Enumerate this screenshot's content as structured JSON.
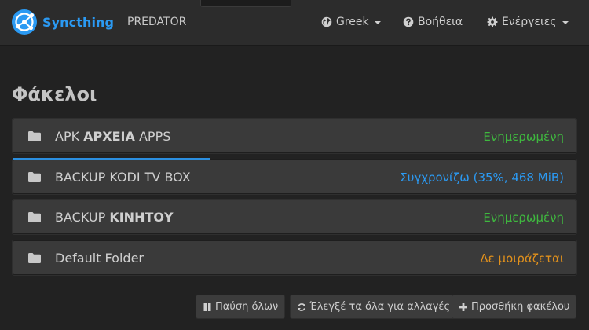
{
  "navbar": {
    "brand_name": "Syncthing",
    "device_name": "PREDATOR",
    "language_label": "Greek",
    "help_label": "Βοήθεια",
    "actions_label": "Ενέργειες",
    "icons": {
      "brand": "syncthing-logo",
      "language": "globe-icon",
      "help": "question-circle-icon",
      "actions": "cog-icon"
    }
  },
  "page": {
    "heading": "Φάκελοι"
  },
  "folders": [
    {
      "name_prefix": "APK ",
      "name_bold": "ΑΡΧΕΙΑ",
      "name_suffix": " APPS",
      "status": "Ενημερωμένη",
      "status_color": "#3fb93f"
    },
    {
      "name_prefix": "BACKUP KODI TV BOX",
      "name_bold": "",
      "name_suffix": "",
      "status": "Συγχρονίζω (35%, 468 MiB)",
      "status_color": "#2b9af3",
      "progress": 0.35
    },
    {
      "name_prefix": "BACKUP ",
      "name_bold": "ΚΙΝΗΤΟΥ",
      "name_suffix": "",
      "status": "Ενημερωμένη",
      "status_color": "#3fb93f"
    },
    {
      "name_prefix": "Default Folder",
      "name_bold": "",
      "name_suffix": "",
      "status": "Δε μοιράζεται",
      "status_color": "#e0901c"
    }
  ],
  "buttons": {
    "pause_all": "Παύση όλων",
    "rescan_all": "Έλεγξέ τα όλα για αλλαγές",
    "add_folder": "Προσθήκη φακέλου"
  },
  "colors": {
    "accent": "#2b9af3",
    "ok": "#3fb93f",
    "warning": "#e0901c",
    "background": "#222222",
    "panel": "#3a3a3a"
  }
}
